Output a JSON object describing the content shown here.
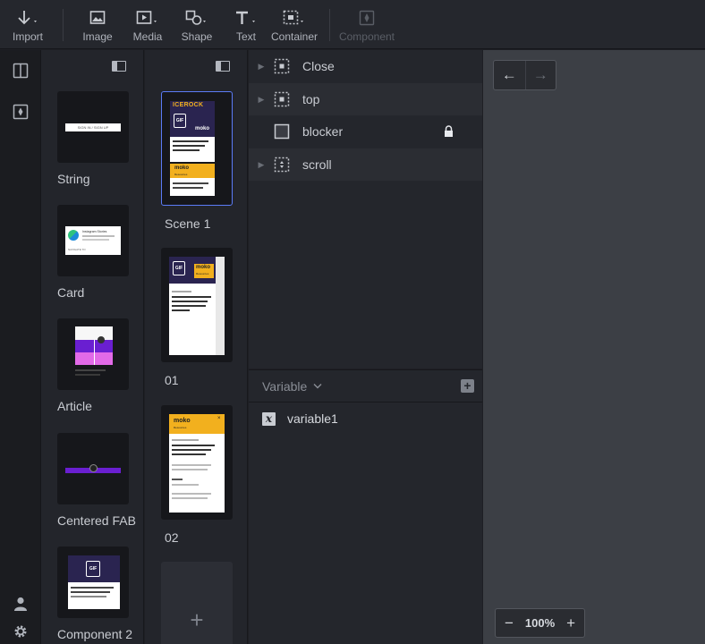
{
  "toolbar": {
    "items": [
      {
        "label": "Import",
        "icon": "import-icon"
      },
      {
        "label": "Image",
        "icon": "image-icon"
      },
      {
        "label": "Media",
        "icon": "media-icon"
      },
      {
        "label": "Shape",
        "icon": "shape-icon"
      },
      {
        "label": "Text",
        "icon": "text-icon"
      },
      {
        "label": "Container",
        "icon": "container-icon"
      },
      {
        "label": "Component",
        "icon": "component-icon",
        "disabled": true
      }
    ]
  },
  "components": [
    {
      "label": "String",
      "thumb_text": "SIGN IN / SIGN UP"
    },
    {
      "label": "Card",
      "thumb_title": "Instagram Stories",
      "thumb_link": "NAVIGATE TO"
    },
    {
      "label": "Article"
    },
    {
      "label": "Centered FAB"
    },
    {
      "label": "Component 2",
      "thumb_badge": "GIF"
    }
  ],
  "scenes": [
    {
      "label": "Scene 1",
      "selected": true,
      "brand": "ICEROCK",
      "badge": "GIF",
      "logo": "moko",
      "sub": "Resources"
    },
    {
      "label": "01",
      "badge": "GIF",
      "logo": "moko",
      "sub": "Resources"
    },
    {
      "label": "02",
      "logo": "moko",
      "sub": "Resources"
    }
  ],
  "scene_add_label": "+",
  "layers": [
    {
      "name": "Close",
      "icon": "container-dashed-icon",
      "expandable": true,
      "locked": false
    },
    {
      "name": "top",
      "icon": "container-dashed-icon",
      "expandable": true,
      "locked": false
    },
    {
      "name": "blocker",
      "icon": "rectangle-icon",
      "expandable": false,
      "locked": true
    },
    {
      "name": "scroll",
      "icon": "scroll-container-icon",
      "expandable": true,
      "locked": false
    }
  ],
  "variables": {
    "header": "Variable",
    "add_label": "+",
    "items": [
      {
        "name": "variable1",
        "icon_text": "x"
      }
    ]
  },
  "canvas": {
    "back_label": "←",
    "forward_label": "→",
    "zoom": "100%",
    "zoom_out": "−",
    "zoom_in": "+"
  },
  "colors": {
    "accent": "#5b7cf7",
    "yellow": "#f2b01e",
    "purple": "#6a1fd1",
    "magenta": "#e26ae8"
  }
}
